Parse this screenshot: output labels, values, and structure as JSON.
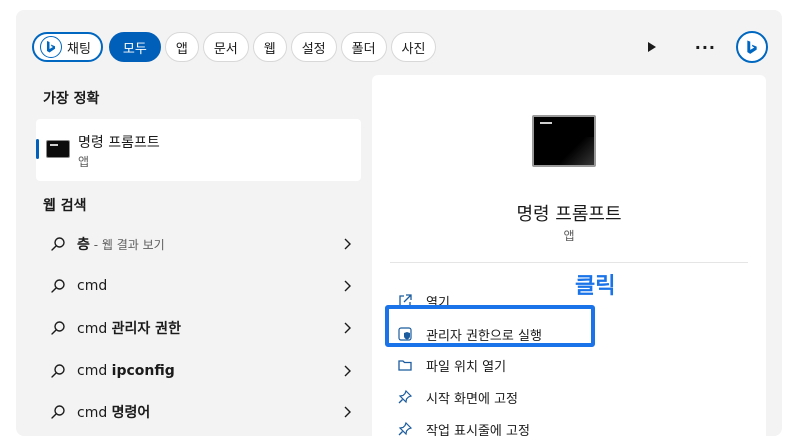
{
  "tabs": [
    {
      "label": "채팅"
    },
    {
      "label": "모두"
    },
    {
      "label": "앱"
    },
    {
      "label": "문서"
    },
    {
      "label": "웹"
    },
    {
      "label": "설정"
    },
    {
      "label": "폴더"
    },
    {
      "label": "사진"
    }
  ],
  "top_right": {
    "more": "···"
  },
  "best_match": {
    "section_title": "가장 정확",
    "name": "명령 프롬프트",
    "type": "앱"
  },
  "web_search": {
    "section_title": "웹 검색",
    "items": [
      {
        "bold": "층",
        "rest": " - 웹 결과 보기"
      },
      {
        "plain": "cmd"
      },
      {
        "prefix": "cmd ",
        "bold": "관리자 권한"
      },
      {
        "prefix": "cmd ",
        "bold": "ipconfig"
      },
      {
        "prefix": "cmd ",
        "bold": "명령어"
      }
    ]
  },
  "preview": {
    "title": "명령 프롬프트",
    "subtitle": "앱",
    "actions": [
      {
        "label": "열기",
        "icon": "open-external-icon"
      },
      {
        "label": "관리자 권한으로 실행",
        "icon": "shield-icon"
      },
      {
        "label": "파일 위치 열기",
        "icon": "folder-icon"
      },
      {
        "label": "시작 화면에 고정",
        "icon": "pin-icon"
      },
      {
        "label": "작업 표시줄에 고정",
        "icon": "pin-icon"
      }
    ]
  },
  "annotation": {
    "click_label": "클릭",
    "color": "#1a73e8"
  },
  "colors": {
    "accent": "#005fb8",
    "panel_bg": "#f3f3f3"
  }
}
